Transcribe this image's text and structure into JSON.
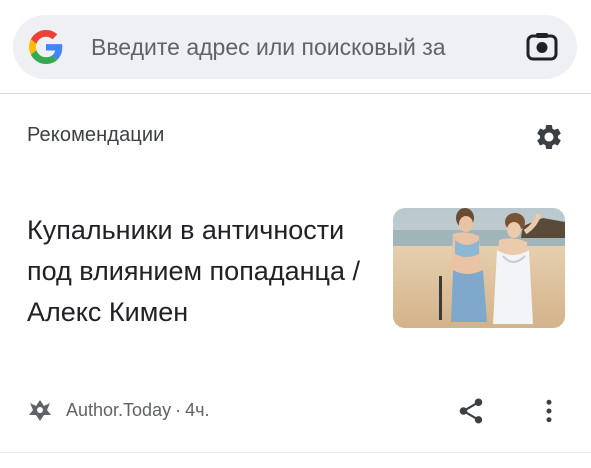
{
  "search": {
    "placeholder": "Введите адрес или поисковый за",
    "logo_icon": "google-g-icon",
    "camera_icon": "google-lens-icon"
  },
  "feed": {
    "section_title": "Рекомендации",
    "settings_icon": "gear-icon"
  },
  "article": {
    "title": "Купальники в античности под влиянием попаданца / Алекс Кимен",
    "source": "Author.Today",
    "separator": "·",
    "time": "4ч.",
    "share_icon": "share-icon",
    "more_icon": "more-vert-icon"
  },
  "colors": {
    "search_bg": "#eef0f3",
    "divider": "#dadce0",
    "text_primary": "#202124",
    "text_secondary": "#5f6368",
    "google_blue": "#4285F4",
    "google_red": "#EA4335",
    "google_yellow": "#FBBC05",
    "google_green": "#34A853"
  }
}
